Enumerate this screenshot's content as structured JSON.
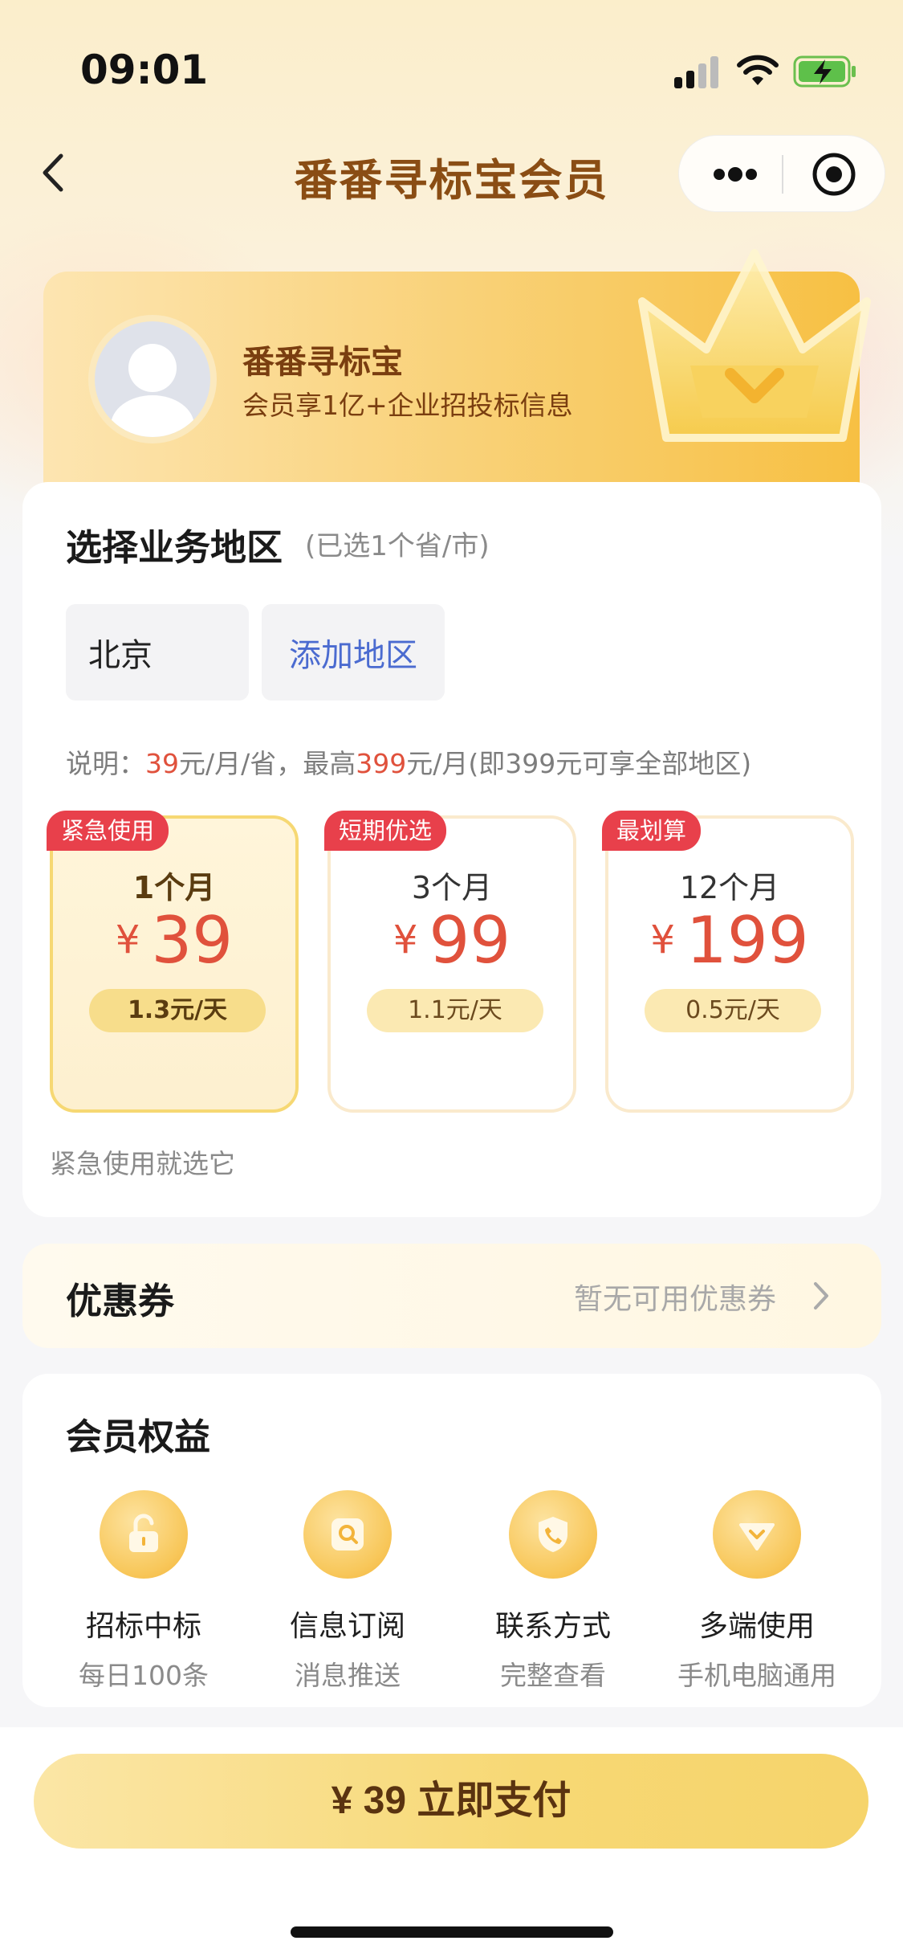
{
  "status_bar": {
    "time": "09:01"
  },
  "nav": {
    "title": "番番寻标宝会员"
  },
  "banner": {
    "name": "番番寻标宝",
    "subtitle": "会员享1亿+企业招投标信息"
  },
  "region": {
    "title": "选择业务地区",
    "note": "(已选1个省/市)",
    "selected_chip": "北京",
    "add_chip": "添加地区",
    "desc": {
      "prefix": "说明：",
      "price1": "39",
      "mid": "元/月/省，最高",
      "price2": "399",
      "suffix": "元/月(即399元可享全部地区)"
    }
  },
  "plans": [
    {
      "tag": "紧急使用",
      "period": "1个月",
      "currency": "¥",
      "price": "39",
      "per_day": "1.3元/天",
      "selected": true
    },
    {
      "tag": "短期优选",
      "period": "3个月",
      "currency": "¥",
      "price": "99",
      "per_day": "1.1元/天",
      "selected": false
    },
    {
      "tag": "最划算",
      "period": "12个月",
      "currency": "¥",
      "price": "199",
      "per_day": "0.5元/天",
      "selected": false
    }
  ],
  "plan_hint": "紧急使用就选它",
  "coupon": {
    "label": "优惠券",
    "value": "暂无可用优惠券"
  },
  "benefits": {
    "title": "会员权益",
    "items": [
      {
        "title": "招标中标",
        "subtitle": "每日100条",
        "icon": "unlock-icon"
      },
      {
        "title": "信息订阅",
        "subtitle": "消息推送",
        "icon": "search-icon"
      },
      {
        "title": "联系方式",
        "subtitle": "完整查看",
        "icon": "phone-icon"
      },
      {
        "title": "多端使用",
        "subtitle": "手机电脑通用",
        "icon": "diamond-icon"
      }
    ]
  },
  "pay_button": {
    "label": "¥ 39  立即支付"
  },
  "colors": {
    "accent": "#f7d874",
    "price_red": "#e0513c",
    "tag_red": "#e8404b",
    "brand_brown": "#8a4d14"
  }
}
